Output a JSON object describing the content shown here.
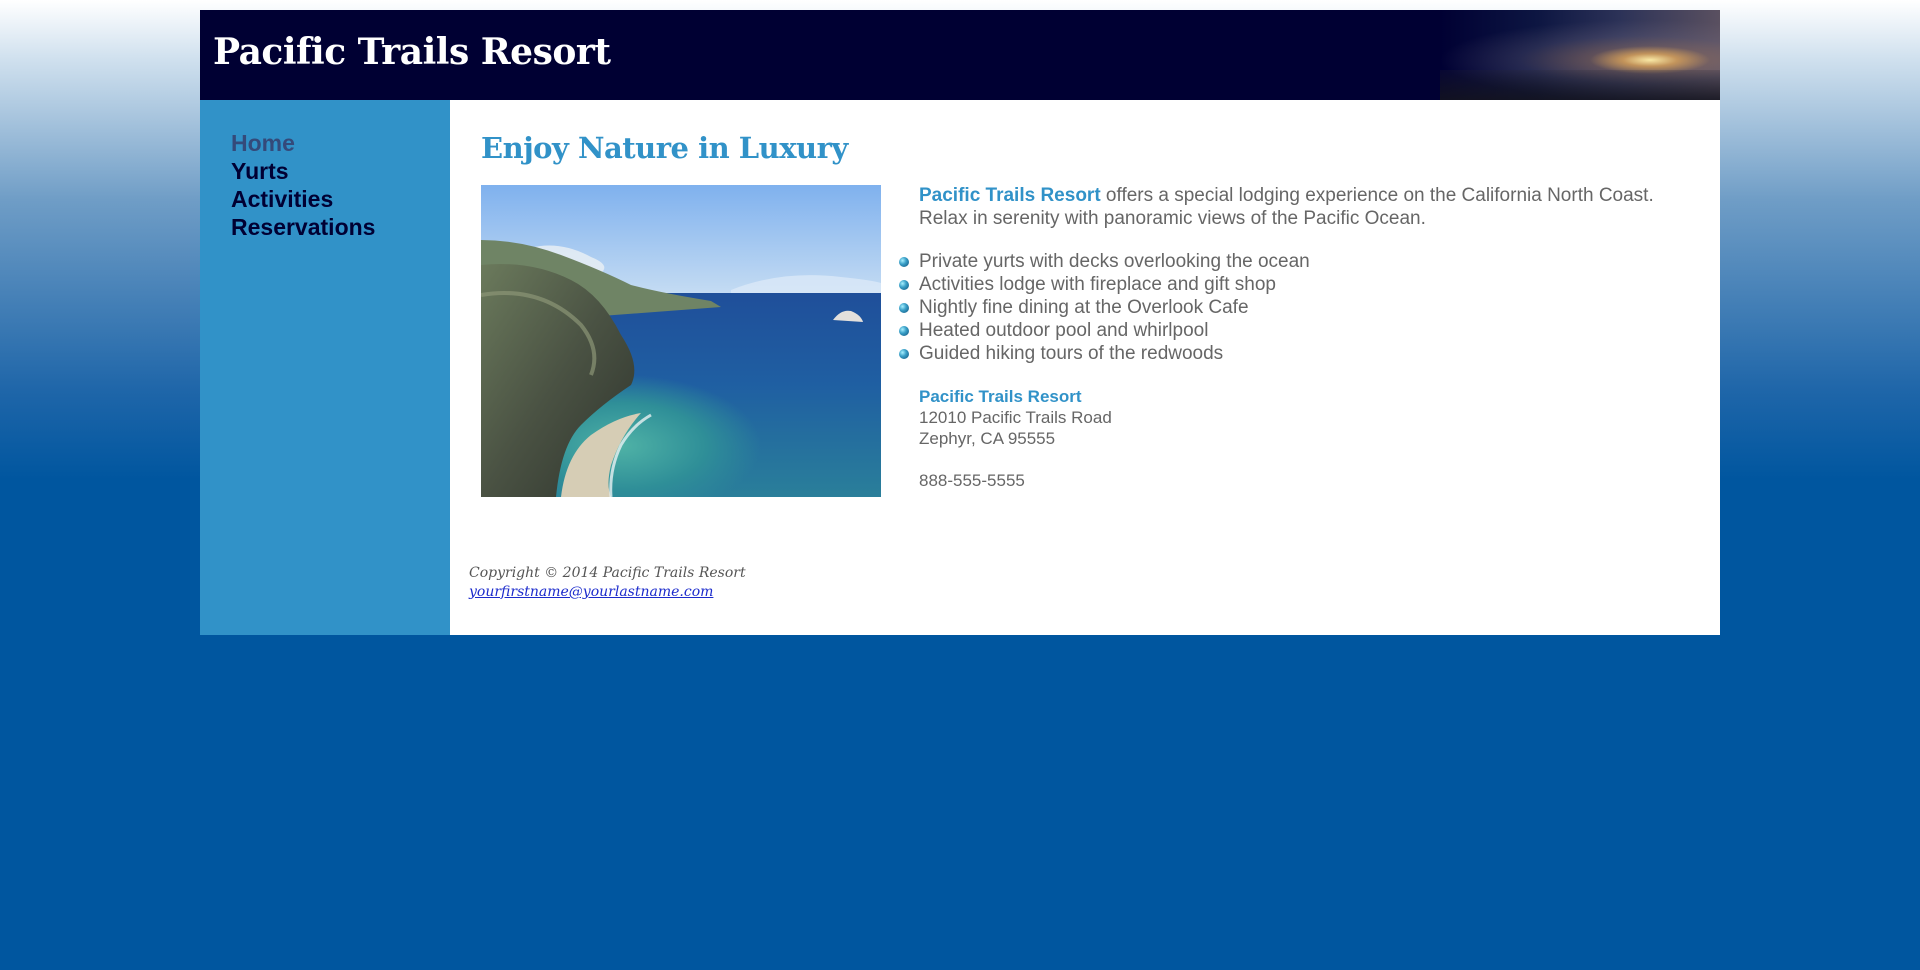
{
  "header": {
    "title": "Pacific Trails Resort"
  },
  "nav": {
    "items": [
      {
        "label": "Home"
      },
      {
        "label": "Yurts"
      },
      {
        "label": "Activities"
      },
      {
        "label": "Reservations"
      }
    ]
  },
  "main": {
    "heading": "Enjoy Nature in Luxury",
    "intro": {
      "brand": "Pacific Trails Resort",
      "text": " offers a special lodging experience on the California North Coast. Relax in serenity with panoramic views of the Pacific Ocean."
    },
    "features": [
      "Private yurts with decks overlooking the ocean",
      "Activities lodge with fireplace and gift shop",
      "Nightly fine dining at the Overlook Cafe",
      "Heated outdoor pool and whirlpool",
      "Guided hiking tours of the redwoods"
    ],
    "address": {
      "name": "Pacific Trails Resort",
      "street": "12010 Pacific Trails Road",
      "city": "Zephyr, CA 95555",
      "phone": "888-555-5555"
    }
  },
  "footer": {
    "copyright": "Copyright © 2014 Pacific Trails Resort",
    "email": "yourfirstname@yourlastname.com"
  },
  "colors": {
    "header_bg": "#000033",
    "nav_bg": "#3192c8",
    "accent": "#3192c8",
    "page_bg": "#00569f",
    "body_text": "#666666"
  },
  "icons": {
    "feature_bullet": "blue-orb-bullet-icon"
  }
}
